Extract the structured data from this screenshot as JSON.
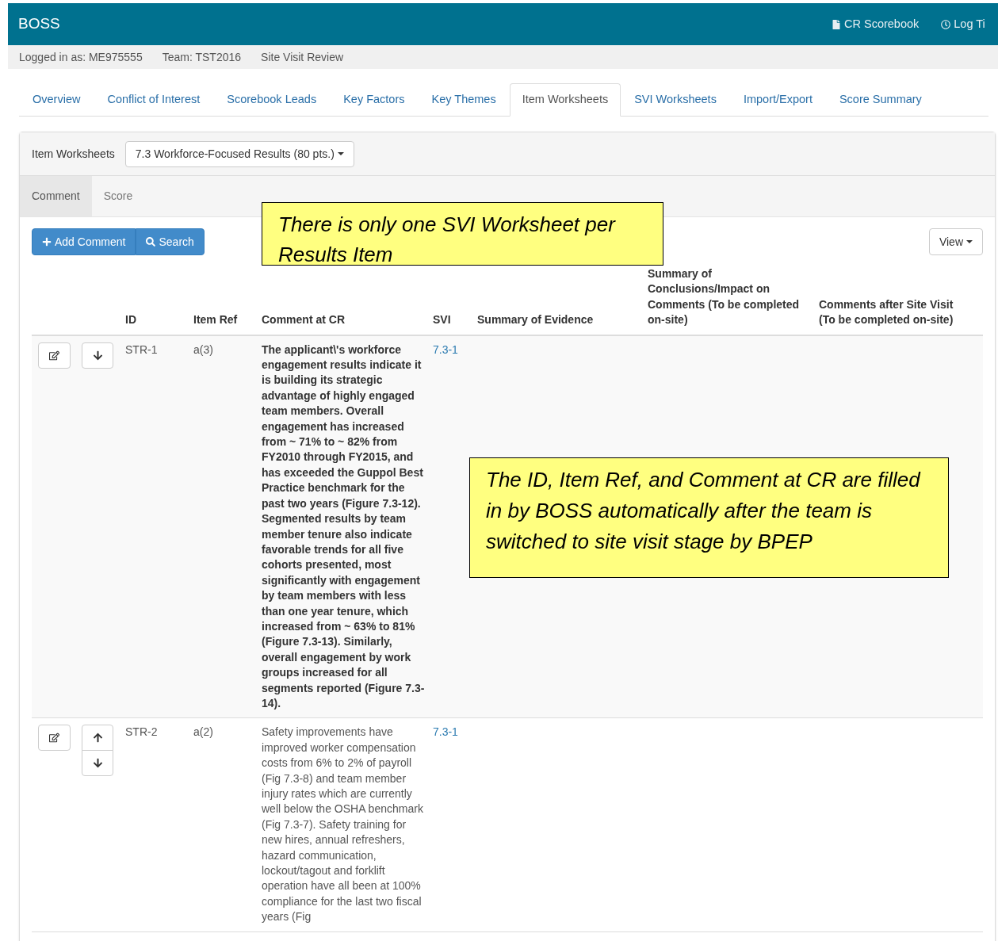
{
  "app_bar": {
    "brand": "BOSS",
    "links": [
      {
        "label": "CR Scorebook",
        "kind": "file"
      },
      {
        "label": "Log Ti",
        "kind": "clock"
      }
    ]
  },
  "info_bar": [
    "Logged in as: ME975555",
    "Team: TST2016",
    "Site Visit Review"
  ],
  "tabs": [
    {
      "label": "Overview",
      "selected": false
    },
    {
      "label": "Conflict of Interest",
      "selected": false
    },
    {
      "label": "Scorebook Leads",
      "selected": false
    },
    {
      "label": "Key Factors",
      "selected": false
    },
    {
      "label": "Key Themes",
      "selected": false
    },
    {
      "label": "Item Worksheets",
      "selected": true
    },
    {
      "label": "SVI Worksheets",
      "selected": false
    },
    {
      "label": "Import/Export",
      "selected": false
    },
    {
      "label": "Score Summary",
      "selected": false
    }
  ],
  "worksheet_picker": {
    "label": "Item Worksheets",
    "value": "7.3 Workforce-Focused Results (80 pts.)"
  },
  "subtabs": [
    {
      "label": "Comment",
      "selected": true
    },
    {
      "label": "Score",
      "selected": false
    }
  ],
  "toolbar": {
    "add_button": "Add Comment",
    "search_button": "Search",
    "view_button": "View"
  },
  "table": {
    "columns": [
      "ID",
      "Item Ref",
      "Comment at CR",
      "SVI",
      "Summary of Evidence",
      "Summary of Conclusions/Impact on Comments (To be completed on-site)",
      "Comments after Site Visit (To be completed on-site)"
    ],
    "rows": [
      {
        "id": "STR-1",
        "item_ref": "a(3)",
        "comment": "The applicant\\'s workforce engagement results indicate it is building its strategic advantage of highly engaged team members. Overall engagement has increased from ~ 71% to ~ 82% from FY2010 through FY2015, and has exceeded the Guppol Best Practice benchmark for the past two years (Figure 7.3-12). Segmented results by team member tenure also indicate favorable trends for all five cohorts presented, most significantly with engagement by team members with less than one year tenure, which increased from ~ 63% to 81% (Figure 7.3-13). Similarly, overall engagement by work groups increased for all segments reported (Figure 7.3-14).",
        "bold": true,
        "svi": "7.3-1",
        "can_move_up": false,
        "can_move_down": true
      },
      {
        "id": "STR-2",
        "item_ref": "a(2)",
        "comment": "Safety improvements have improved worker compensation costs from 6% to 2% of payroll (Fig 7.3-8) and team member injury rates which are currently well below the OSHA benchmark (Fig 7.3-7). Safety training for new hires, annual refreshers, hazard communication, lockout/tagout and forklift operation have all been at 100% compliance for the last two fiscal years (Fig",
        "bold": false,
        "svi": "7.3-1",
        "can_move_up": true,
        "can_move_down": true
      }
    ]
  },
  "callouts": [
    "There is only one SVI Worksheet per Results Item",
    "The ID, Item Ref, and Comment at CR are filled in by BOSS automatically after the team is switched to site visit stage by BPEP"
  ]
}
